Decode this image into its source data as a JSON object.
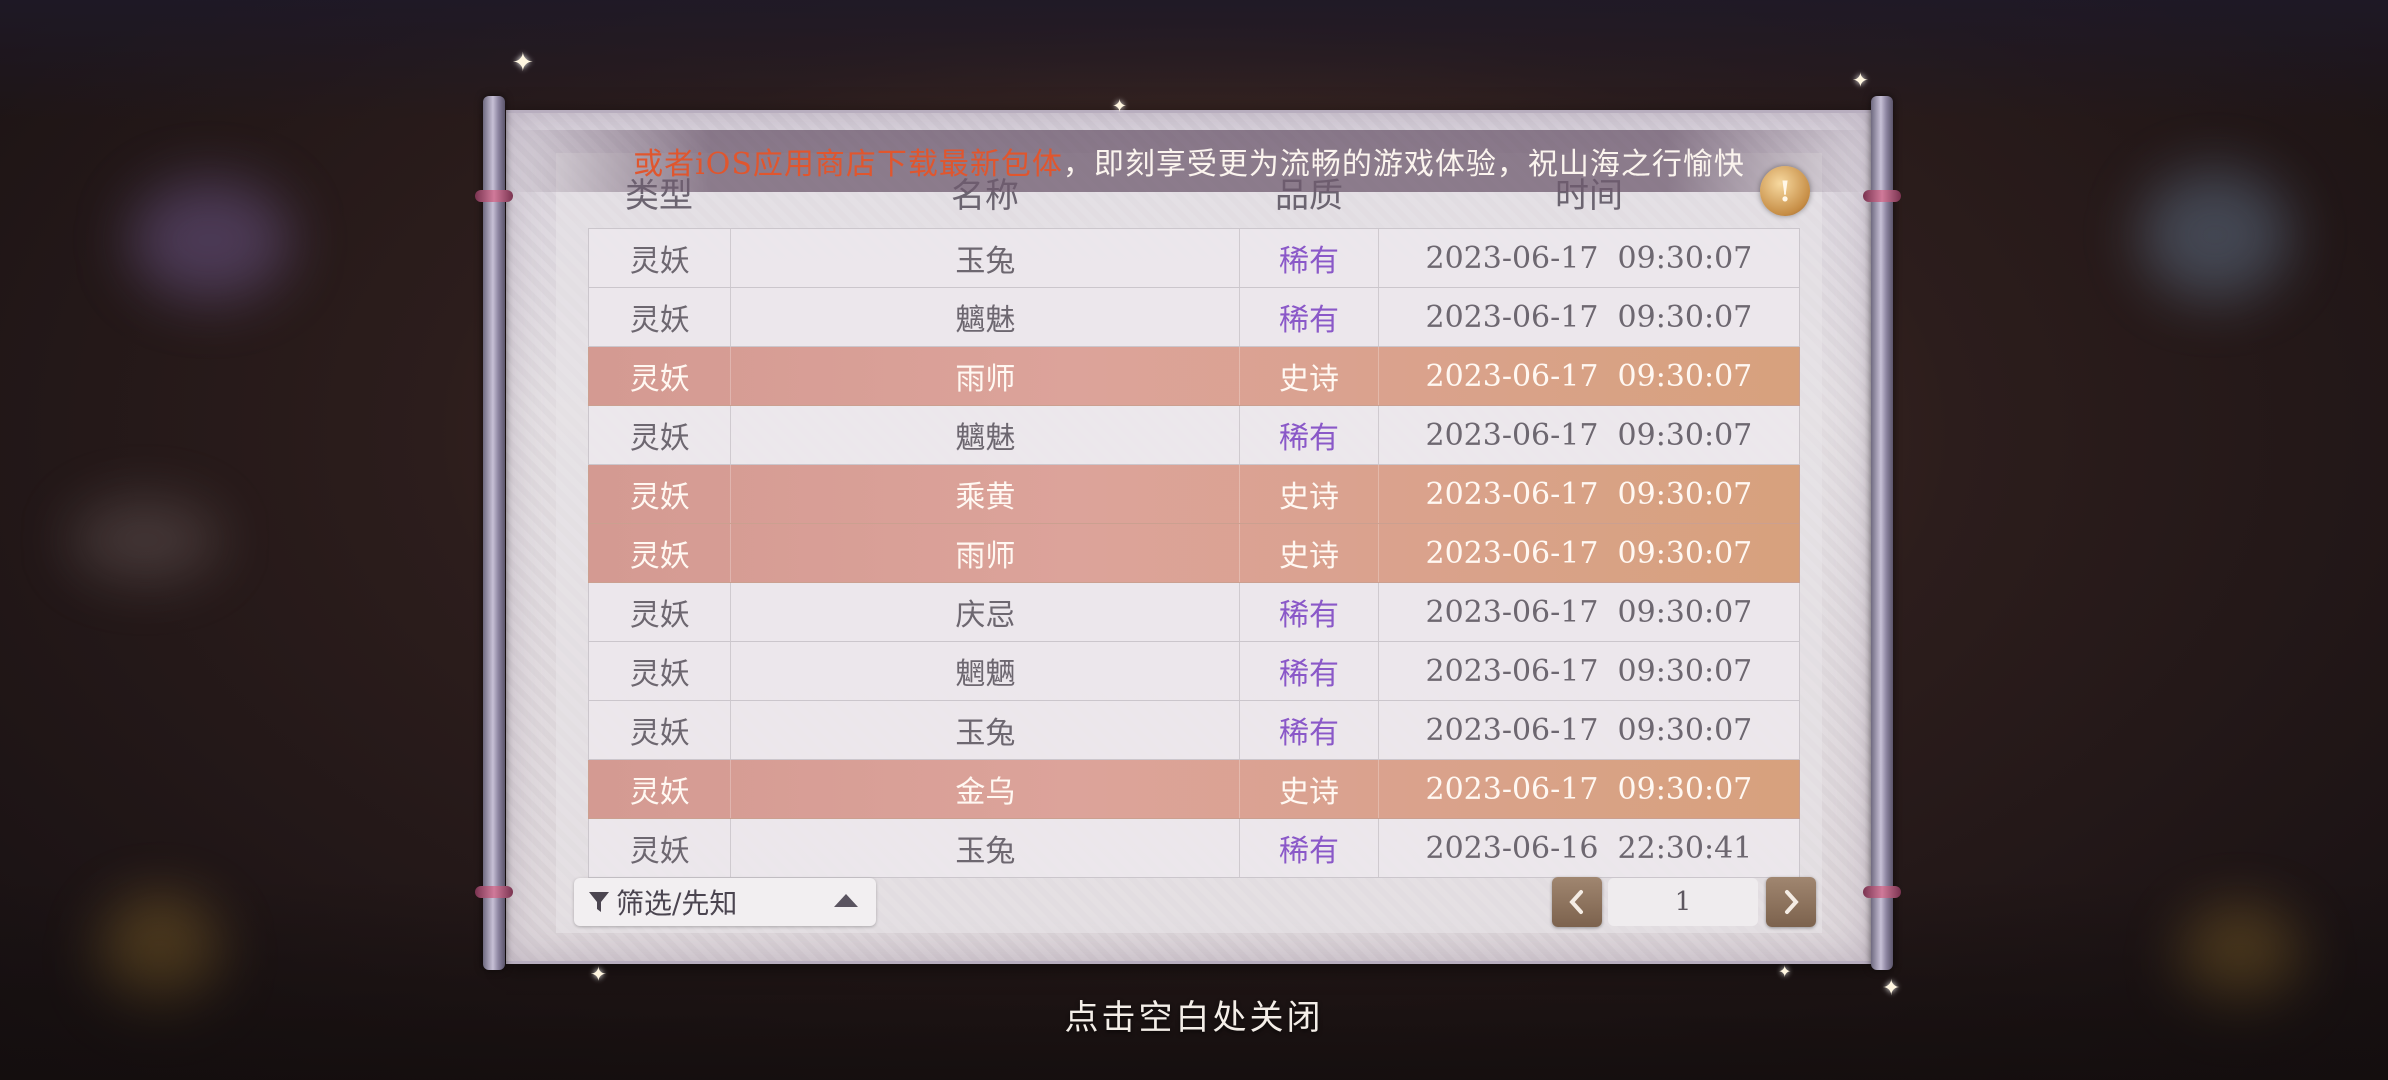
{
  "notice": {
    "red_text": "或者iOS应用商店下载最新包体",
    "white_text": "，即刻享受更为流畅的游戏体验，祝山海之行愉快"
  },
  "columns": [
    "类型",
    "名称",
    "品质",
    "时间"
  ],
  "rows": [
    {
      "type": "灵妖",
      "name": "玉兔",
      "quality": "稀有",
      "time": "2023-06-17  09:30:07",
      "tier": "rare"
    },
    {
      "type": "灵妖",
      "name": "魑魅",
      "quality": "稀有",
      "time": "2023-06-17  09:30:07",
      "tier": "rare"
    },
    {
      "type": "灵妖",
      "name": "雨师",
      "quality": "史诗",
      "time": "2023-06-17  09:30:07",
      "tier": "epic"
    },
    {
      "type": "灵妖",
      "name": "魑魅",
      "quality": "稀有",
      "time": "2023-06-17  09:30:07",
      "tier": "rare"
    },
    {
      "type": "灵妖",
      "name": "乘黄",
      "quality": "史诗",
      "time": "2023-06-17  09:30:07",
      "tier": "epic"
    },
    {
      "type": "灵妖",
      "name": "雨师",
      "quality": "史诗",
      "time": "2023-06-17  09:30:07",
      "tier": "epic"
    },
    {
      "type": "灵妖",
      "name": "庆忌",
      "quality": "稀有",
      "time": "2023-06-17  09:30:07",
      "tier": "rare"
    },
    {
      "type": "灵妖",
      "name": "魍魉",
      "quality": "稀有",
      "time": "2023-06-17  09:30:07",
      "tier": "rare"
    },
    {
      "type": "灵妖",
      "name": "玉兔",
      "quality": "稀有",
      "time": "2023-06-17  09:30:07",
      "tier": "rare"
    },
    {
      "type": "灵妖",
      "name": "金乌",
      "quality": "史诗",
      "time": "2023-06-17  09:30:07",
      "tier": "epic"
    },
    {
      "type": "灵妖",
      "name": "玉兔",
      "quality": "稀有",
      "time": "2023-06-16  22:30:41",
      "tier": "rare"
    }
  ],
  "filter": {
    "label": "筛选/先知",
    "icon": "funnel-icon"
  },
  "pager": {
    "page": "1",
    "prev_icon": "chevron-left-icon",
    "next_icon": "chevron-right-icon"
  },
  "close_icon": "exclamation-icon",
  "hint": "点击空白处关闭",
  "colors": {
    "rare": "#8a58c8",
    "epic_row": "#d49a92",
    "notice_red": "#e0562e"
  }
}
